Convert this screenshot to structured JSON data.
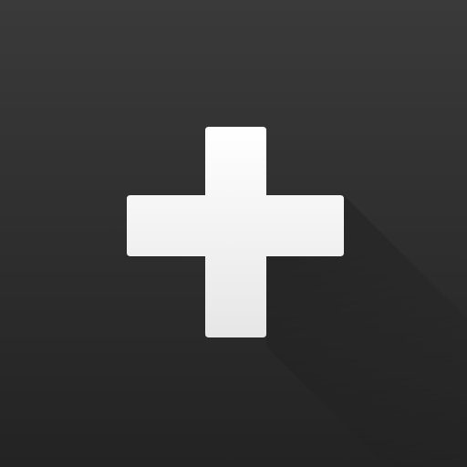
{
  "tile": {
    "icon": "plus-icon",
    "background_top": "#3a3a3a",
    "background_bottom": "#232323",
    "icon_color_top": "#ffffff",
    "icon_color_bottom": "#e6e6e6",
    "shadow_color": "#1a1a1a"
  }
}
